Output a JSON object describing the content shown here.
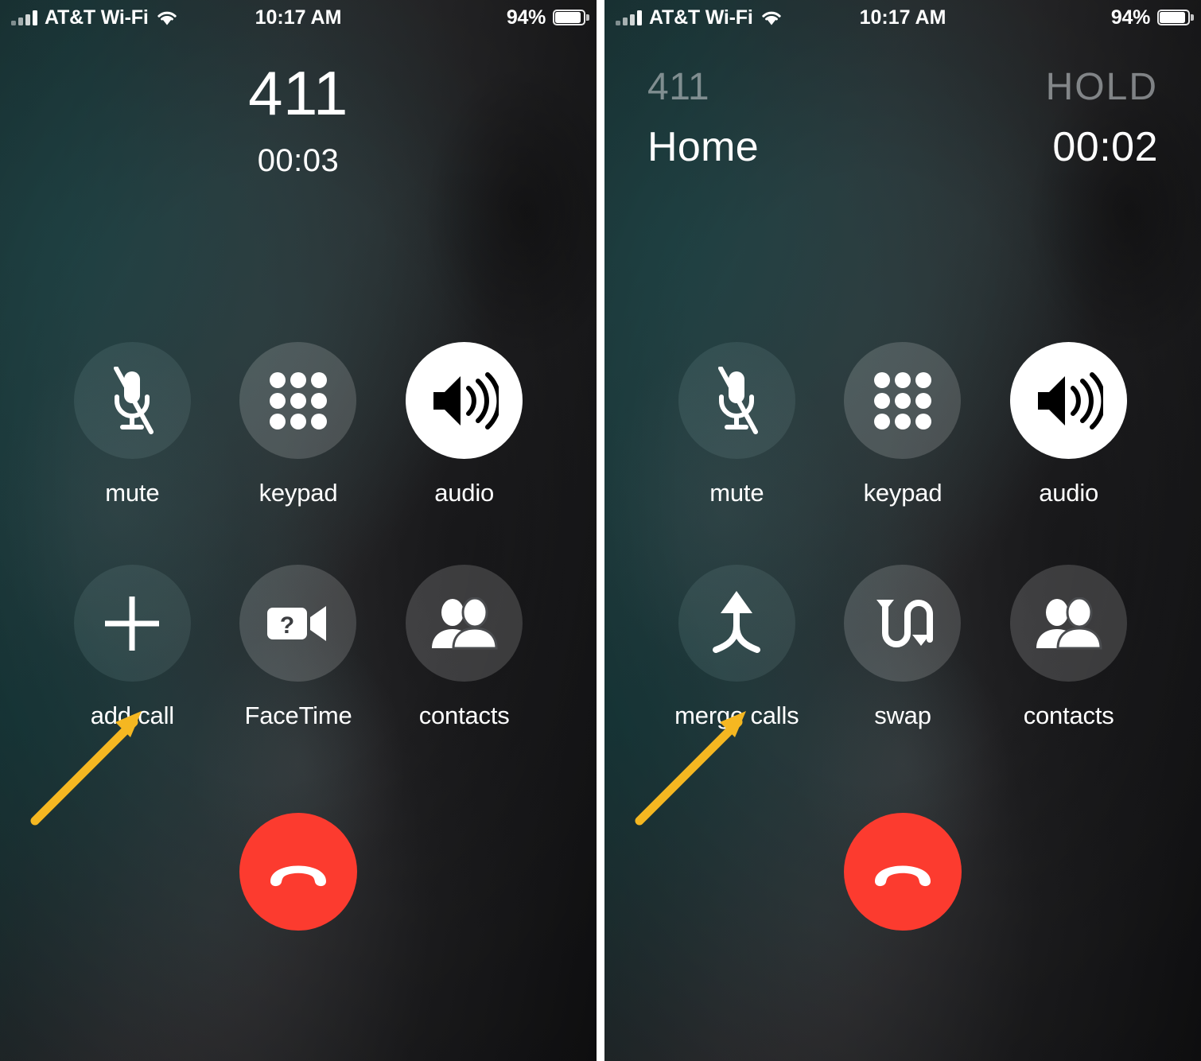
{
  "screens": [
    {
      "id": "single-call",
      "status_bar": {
        "signal_icon": "cellular-signal-icon",
        "carrier": "AT&T Wi-Fi",
        "wifi_icon": "wifi-icon",
        "time": "10:17 AM",
        "battery_percent": "94%",
        "battery_icon": "battery-icon"
      },
      "header": {
        "mode": "single",
        "number": "411",
        "duration": "00:03"
      },
      "actions": [
        {
          "label": "mute",
          "icon": "microphone-slash-icon",
          "style": "teal"
        },
        {
          "label": "keypad",
          "icon": "keypad-dots-icon",
          "style": "grey"
        },
        {
          "label": "audio",
          "icon": "speaker-waves-icon",
          "style": "white"
        },
        {
          "label": "add call",
          "icon": "plus-icon",
          "style": "teal"
        },
        {
          "label": "FaceTime",
          "icon": "facetime-video-unavailable-icon",
          "style": "grey"
        },
        {
          "label": "contacts",
          "icon": "contacts-people-icon",
          "style": "grey"
        }
      ],
      "end_call": {
        "icon": "hang-up-phone-icon",
        "color": "#fc3b2f"
      },
      "annotation": {
        "icon": "yellow-arrow-icon",
        "color": "#f5b721",
        "points_to": "add call"
      }
    },
    {
      "id": "merge-call",
      "status_bar": {
        "signal_icon": "cellular-signal-icon",
        "carrier": "AT&T Wi-Fi",
        "wifi_icon": "wifi-icon",
        "time": "10:17 AM",
        "battery_percent": "94%",
        "battery_icon": "battery-icon"
      },
      "header": {
        "mode": "dual",
        "held_number": "411",
        "held_state": "HOLD",
        "active_name": "Home",
        "active_duration": "00:02"
      },
      "actions": [
        {
          "label": "mute",
          "icon": "microphone-slash-icon",
          "style": "teal"
        },
        {
          "label": "keypad",
          "icon": "keypad-dots-icon",
          "style": "grey"
        },
        {
          "label": "audio",
          "icon": "speaker-waves-icon",
          "style": "white"
        },
        {
          "label": "merge calls",
          "icon": "merge-arrows-icon",
          "style": "teal"
        },
        {
          "label": "swap",
          "icon": "swap-arrows-icon",
          "style": "grey"
        },
        {
          "label": "contacts",
          "icon": "contacts-people-icon",
          "style": "grey"
        }
      ],
      "end_call": {
        "icon": "hang-up-phone-icon",
        "color": "#fc3b2f"
      },
      "annotation": {
        "icon": "yellow-arrow-icon",
        "color": "#f5b721",
        "points_to": "merge calls"
      }
    }
  ],
  "colors": {
    "end_call_red": "#fc3b2f",
    "annotation_yellow": "#f5b721",
    "teal_background": "#1f3a3c",
    "dark_background": "#1a1a1c",
    "divider_white": "#ffffff"
  }
}
